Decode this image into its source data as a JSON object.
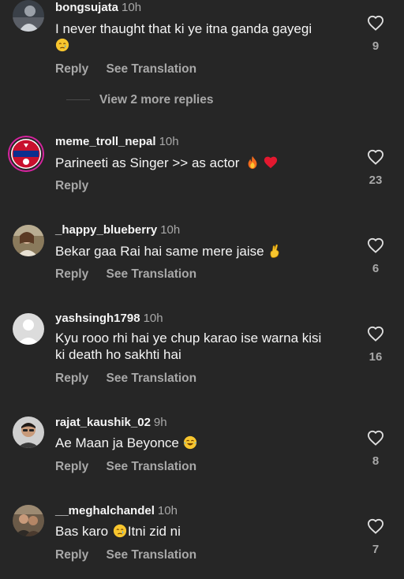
{
  "comments": [
    {
      "username": "bongsujata",
      "time": "10h",
      "text": "I never thaught that ki ye itna ganda gayegi",
      "emoji": "crying-face",
      "reply_label": "Reply",
      "translate_label": "See Translation",
      "likes": "9"
    },
    {
      "username": "meme_troll_nepal",
      "time": "10h",
      "text": "Parineeti as Singer >> as actor",
      "emoji": "fire, red-heart",
      "reply_label": "Reply",
      "likes": "23"
    },
    {
      "username": "_happy_blueberry",
      "time": "10h",
      "text": "Bekar gaa Rai hai same mere jaise",
      "emoji": "crossed-fingers",
      "reply_label": "Reply",
      "translate_label": "See Translation",
      "likes": "6"
    },
    {
      "username": "yashsingh1798",
      "time": "10h",
      "text": "Kyu rooo rhi hai ye chup karao ise warna kisi ki death ho sakhti hai",
      "reply_label": "Reply",
      "translate_label": "See Translation",
      "likes": "16"
    },
    {
      "username": "rajat_kaushik_02",
      "time": "9h",
      "text": "Ae Maan ja Beyonce",
      "emoji": "face-with-tears-of-joy",
      "reply_label": "Reply",
      "translate_label": "See Translation",
      "likes": "8"
    },
    {
      "username": "__meghalchandel",
      "time": "10h",
      "text_before": "Bas karo",
      "text_after": "Itni zid ni",
      "emoji": "crying-face",
      "reply_label": "Reply",
      "translate_label": "See Translation",
      "likes": "7"
    }
  ],
  "view_more_replies": "View 2 more replies",
  "colors": {
    "background": "#262626",
    "primary_text": "#f5f5f5",
    "secondary_text": "#a8a8a8"
  }
}
